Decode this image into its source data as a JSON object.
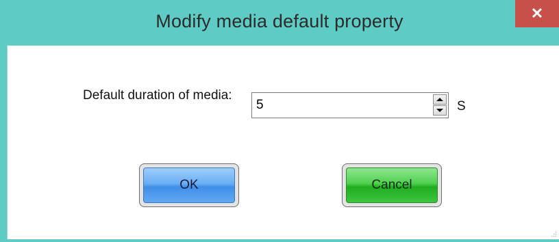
{
  "window": {
    "title": "Modify media default property",
    "close_glyph": "✕",
    "accent_color": "#5ecbc5",
    "close_color": "#c7504a"
  },
  "form": {
    "duration_label": "Default duration of media:",
    "duration_value": "5",
    "unit": "S"
  },
  "buttons": {
    "ok_label": "OK",
    "cancel_label": "Cancel"
  },
  "icons": {
    "close": "close-icon",
    "spin_up": "spin-up-icon",
    "spin_down": "spin-down-icon",
    "resize_grip": "resize-grip-icon"
  }
}
